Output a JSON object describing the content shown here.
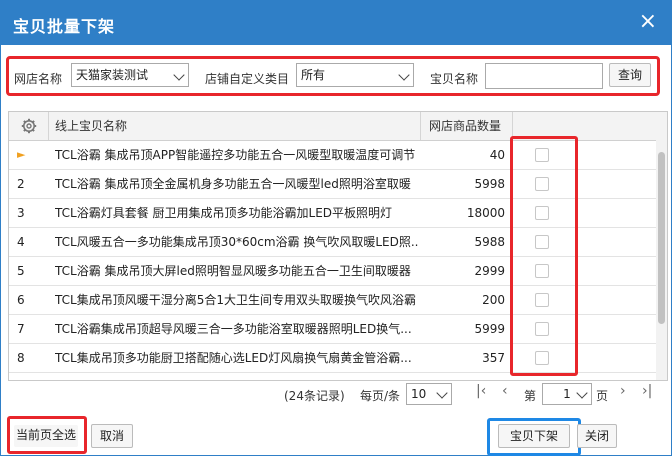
{
  "dialog": {
    "title": "宝贝批量下架",
    "close_glyph": "×"
  },
  "filter": {
    "shop_label": "网店名称",
    "shop_value": "天猫家装测试",
    "category_label": "店铺自定义类目",
    "category_value": "所有",
    "item_label": "宝贝名称",
    "item_placeholder": "",
    "query_label": "查询"
  },
  "grid": {
    "columns": [
      "线上宝贝名称",
      "网店商品数量"
    ],
    "current_row_marker": "►",
    "rows": [
      {
        "no": "",
        "name": "TCL浴霸 集成吊顶APP智能遥控多功能五合一风暖型取暖温度可调节",
        "qty": "40"
      },
      {
        "no": "2",
        "name": "TCL浴霸 集成吊顶全金属机身多功能五合一风暖型led照明浴室取暖",
        "qty": "5998"
      },
      {
        "no": "3",
        "name": "TCL浴霸灯具套餐 厨卫用集成吊顶多功能浴霸加LED平板照明灯",
        "qty": "18000"
      },
      {
        "no": "4",
        "name": "TCL风暖五合一多功能集成吊顶30*60cm浴霸 换气吹风取暖LED照...",
        "qty": "5988"
      },
      {
        "no": "5",
        "name": "TCL浴霸 集成吊顶大屏led照明智显风暖多功能五合一卫生间取暖器",
        "qty": "2999"
      },
      {
        "no": "6",
        "name": "TCL集成吊顶风暖干湿分离5合1大卫生间专用双头取暖换气吹风浴霸",
        "qty": "200"
      },
      {
        "no": "7",
        "name": "TCL浴霸集成吊顶超导风暖三合一多功能浴室取暖器照明LED换气...",
        "qty": "5999"
      },
      {
        "no": "8",
        "name": "TCL集成吊顶多功能厨卫搭配随心选LED灯风扇换气扇黄金管浴霸...",
        "qty": "357"
      }
    ]
  },
  "pager": {
    "total_text": "(24条记录)",
    "per_page_label": "每页/条",
    "per_page_value": "10",
    "page_prefix": "第",
    "page_value": "1",
    "page_suffix": "页",
    "first_glyph": "|‹",
    "prev_glyph": "‹",
    "next_glyph": "›",
    "last_glyph": "›|"
  },
  "footer": {
    "select_page_label": "当前页全选",
    "cancel_label": "取消",
    "delist_label": "宝贝下架",
    "close_label": "关闭"
  },
  "colors": {
    "titlebar": "#2f7fc7",
    "highlight_red": "#e8262b",
    "highlight_blue": "#1e88e5",
    "marker": "#f0a020"
  }
}
